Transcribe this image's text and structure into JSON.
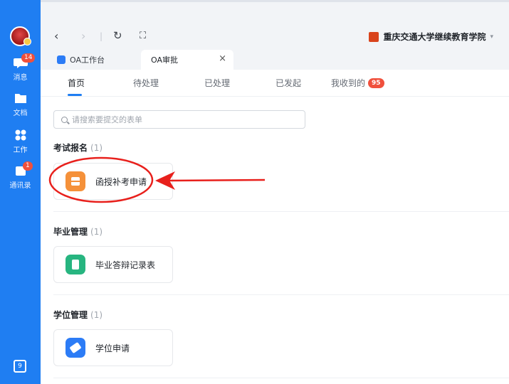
{
  "sidebar": {
    "items": [
      {
        "icon": "chat-icon",
        "label": "消息",
        "badge": "14"
      },
      {
        "icon": "folder-icon",
        "label": "文档"
      },
      {
        "icon": "apps-icon",
        "label": "工作"
      },
      {
        "icon": "contacts-icon",
        "label": "通讯录",
        "badge": "1"
      }
    ],
    "bottom_icon": "calendar-icon",
    "bottom_icon_text": "9"
  },
  "toolbar": {
    "back": "‹",
    "forward": "›",
    "refresh": "↻",
    "expand": "⛶",
    "school_name": "重庆交通大学继续教育学院",
    "caret": "▾"
  },
  "tabs": [
    {
      "label": "OA工作台"
    },
    {
      "label": "OA审批",
      "close": "×"
    }
  ],
  "subtabs": [
    {
      "label": "首页"
    },
    {
      "label": "待处理"
    },
    {
      "label": "已处理"
    },
    {
      "label": "已发起"
    },
    {
      "label": "我收到的",
      "count": "95"
    }
  ],
  "search": {
    "placeholder": "请搜索要提交的表单"
  },
  "sections": [
    {
      "title": "考试报名",
      "count": "(1)",
      "cards": [
        {
          "label": "函授补考申请",
          "icon": "form-icon"
        }
      ]
    },
    {
      "title": "毕业管理",
      "count": "(1)",
      "cards": [
        {
          "label": "毕业答辩记录表",
          "icon": "clipboard-icon"
        }
      ]
    },
    {
      "title": "学位管理",
      "count": "(1)",
      "cards": [
        {
          "label": "学位申请",
          "icon": "handshake-icon"
        }
      ]
    }
  ],
  "colors": {
    "accent": "#1f7ef2",
    "annotation": "#e8201c",
    "badge": "#f0503c"
  }
}
